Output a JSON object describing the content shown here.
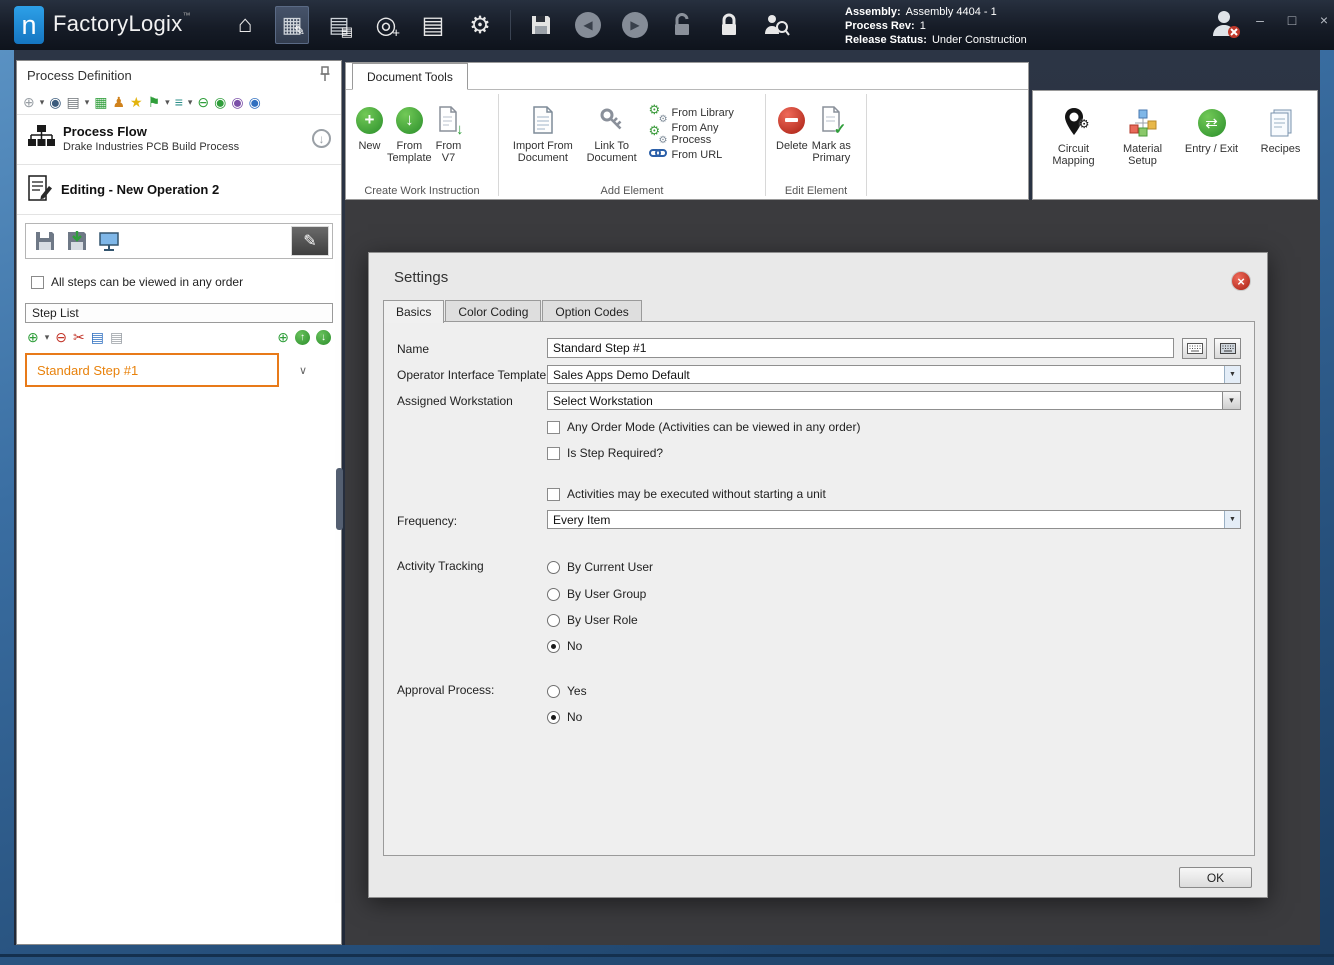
{
  "titlebar": {
    "logo_letter": "n",
    "app_name": "FactoryLogix",
    "trademark": "™",
    "info": {
      "assembly_label": "Assembly:",
      "assembly_value": "Assembly 4404 - 1",
      "process_rev_label": "Process Rev:",
      "process_rev_value": "1",
      "release_status_label": "Release Status:",
      "release_status_value": "Under Construction"
    },
    "window_controls": {
      "minimize": "–",
      "maximize": "□",
      "close": "×"
    }
  },
  "glyphs": {
    "home": "⌂",
    "pencil": "✎",
    "grid": "▤",
    "block": "▦",
    "target": "◎",
    "plus": "+",
    "gear": "⚙",
    "back": "◀",
    "forward": "▶",
    "caret": "▾",
    "chevron": "∨",
    "combo": "▼",
    "oplus": "⊕",
    "ominus": "⊖",
    "minus": "−",
    "arrow_down": "↓",
    "arrow_up": "↑",
    "scissors": "✂",
    "star": "★",
    "flag": "⚑",
    "person": "♟",
    "menu": "≡",
    "dot": "◉",
    "swap": "⇄",
    "check": "✓"
  },
  "left_panel": {
    "title": "Process Definition",
    "process_flow": {
      "title": "Process Flow",
      "subtitle": "Drake Industries PCB Build Process"
    },
    "editing_title": "Editing - New Operation 2",
    "order_checkbox_label": "All steps can be viewed in any order",
    "step_list": {
      "title": "Step List",
      "items": [
        {
          "label": "Standard Step #1",
          "selected": true
        }
      ]
    }
  },
  "ribbon": {
    "tab_label": "Document Tools",
    "groups": {
      "create": {
        "label": "Create Work Instruction",
        "new": "New",
        "from_template": "From\nTemplate",
        "from_v7": "From\nV7"
      },
      "add": {
        "label": "Add Element",
        "import_from_document": "Import From\nDocument",
        "link_to_document": "Link To\nDocument",
        "from_library": "From Library",
        "from_any_process": "From Any Process",
        "from_url": "From URL"
      },
      "edit": {
        "label": "Edit Element",
        "delete": "Delete",
        "mark_as_primary": "Mark as\nPrimary"
      }
    },
    "right_buttons": {
      "circuit_mapping": "Circuit\nMapping",
      "material_setup": "Material\nSetup",
      "entry_exit": "Entry / Exit",
      "recipes": "Recipes"
    }
  },
  "dialog": {
    "title": "Settings",
    "tabs": [
      "Basics",
      "Color Coding",
      "Option Codes"
    ],
    "active_tab": "Basics",
    "name_label": "Name",
    "name_value": "Standard Step #1",
    "template_label": "Operator Interface Template",
    "template_value": "Sales Apps Demo Default",
    "workstation_label": "Assigned Workstation",
    "workstation_placeholder": "Select Workstation",
    "checkbox_any_order": "Any Order Mode (Activities can be viewed in any order)",
    "checkbox_step_required": "Is Step Required?",
    "checkbox_no_unit": "Activities may be executed without starting a unit",
    "frequency_label": "Frequency:",
    "frequency_value": "Every Item",
    "activity_tracking_label": "Activity Tracking",
    "activity_options": [
      "By Current User",
      "By User Group",
      "By User Role",
      "No"
    ],
    "activity_selected": "No",
    "approval_label": "Approval Process:",
    "approval_options": [
      "Yes",
      "No"
    ],
    "approval_selected": "No",
    "ok_label": "OK"
  }
}
